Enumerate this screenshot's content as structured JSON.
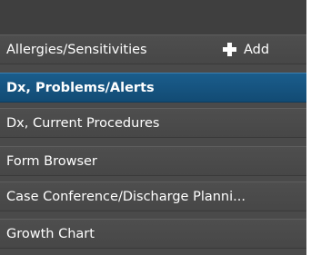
{
  "menu": {
    "items": [
      {
        "label": "Allergies/Sensitivities",
        "selected": false,
        "action_label": "Add",
        "action_icon": "plus-icon"
      },
      {
        "label": "Dx, Problems/Alerts",
        "selected": true
      },
      {
        "label": "Dx, Current Procedures",
        "selected": false
      },
      {
        "label": "Form Browser",
        "selected": false
      },
      {
        "label": "Case Conference/Discharge Planni...",
        "selected": false
      },
      {
        "label": "Growth Chart",
        "selected": false
      }
    ]
  },
  "colors": {
    "panel_background": "#4a4a4a",
    "selected_background": "#1a5d8c",
    "text": "#ffffff"
  }
}
